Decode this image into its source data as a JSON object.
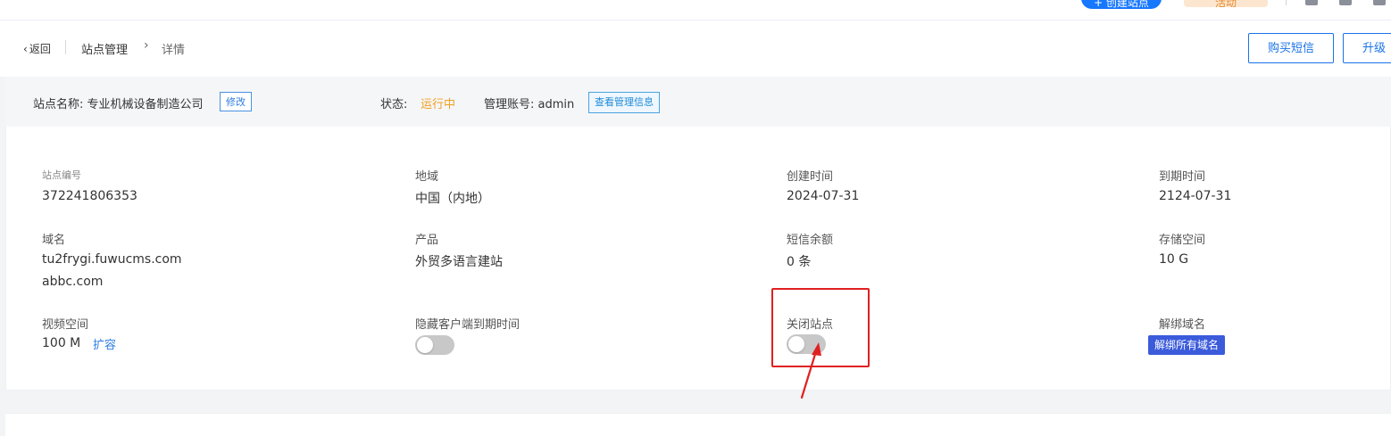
{
  "topbar": {
    "create_label": "+ 创建站点",
    "promo_label": "活动"
  },
  "header": {
    "back_label": "返回",
    "breadcrumb": [
      "站点管理",
      "详情"
    ],
    "buy_sms_label": "购买短信",
    "upgrade_label": "升级"
  },
  "info_bar": {
    "site_name_text": "站点名称: 专业机械设备制造公司",
    "edit_label": "修改",
    "status_label": "状态:",
    "status_value": "运行中",
    "admin_text": "管理账号: admin",
    "view_admin_label": "查看管理信息"
  },
  "details": {
    "site_id_label": "站点编号",
    "site_id_value": "372241806353",
    "region_label": "地域",
    "region_value": "中国（内地）",
    "created_label": "创建时间",
    "created_value": "2024-07-31",
    "expire_label": "到期时间",
    "expire_value": "2124-07-31",
    "domain_label": "域名",
    "domains": [
      "tu2frygi.fuwucms.com",
      "abbc.com"
    ],
    "product_label": "产品",
    "product_value": "外贸多语言建站",
    "sms_label": "短信余额",
    "sms_value": "0 条",
    "storage_label": "存储空间",
    "storage_value": "10 G",
    "video_label": "视频空间",
    "video_value": "100 M",
    "expand_label": "扩容",
    "hide_expire_label": "隐藏客户端到期时间",
    "hide_expire_on": false,
    "close_site_label": "关闭站点",
    "close_site_on": false,
    "unbind_label": "解绑域名",
    "unbind_all_label": "解绑所有域名"
  },
  "colors": {
    "accent": "#1a73e8",
    "status_running": "#f0a020",
    "highlight": "#e02020",
    "unbind_button": "#3b5bdb"
  }
}
